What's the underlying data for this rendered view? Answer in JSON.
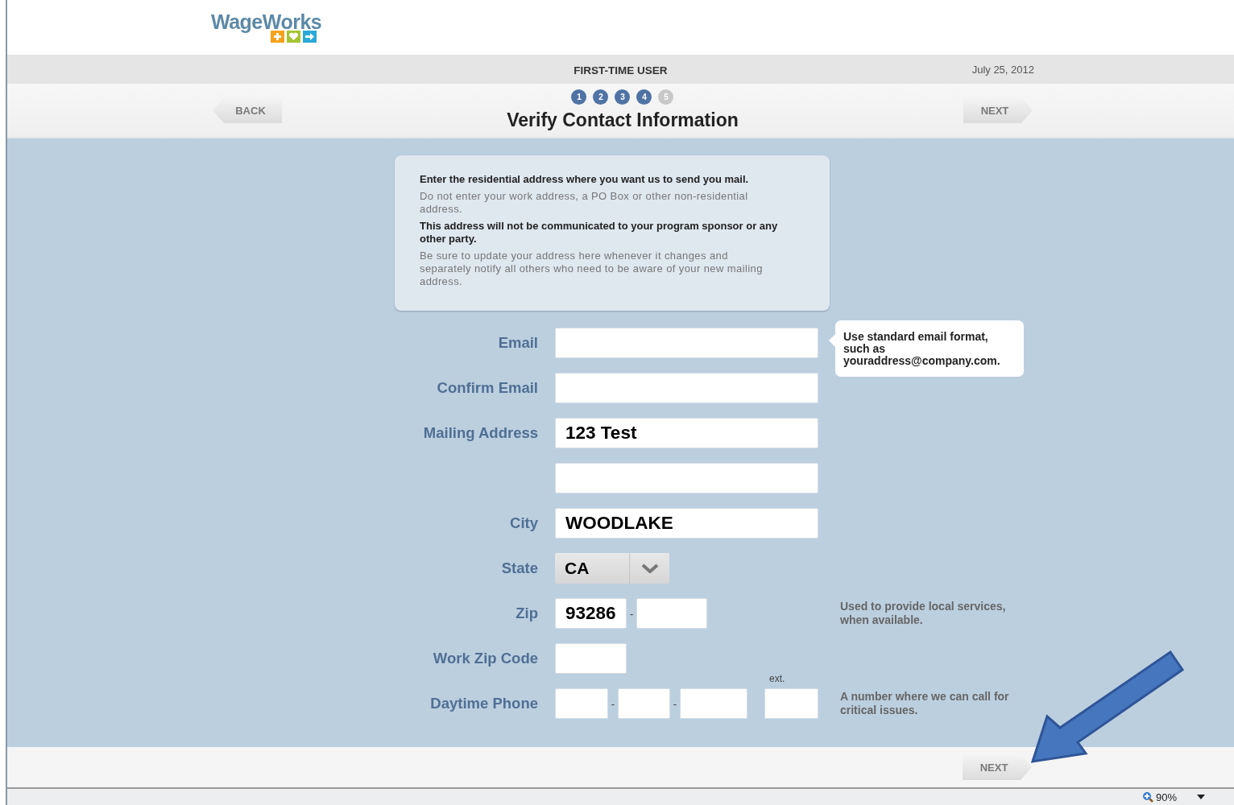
{
  "logo": {
    "text": "WageWorks"
  },
  "header": {
    "title": "FIRST-TIME USER",
    "date": "July 25, 2012"
  },
  "wizard": {
    "back": "BACK",
    "next": "NEXT",
    "title": "Verify Contact Information",
    "steps": [
      {
        "label": "1",
        "done": true
      },
      {
        "label": "2",
        "done": true
      },
      {
        "label": "3",
        "done": true
      },
      {
        "label": "4",
        "done": true
      },
      {
        "label": "5",
        "done": false
      }
    ]
  },
  "notice": [
    {
      "text": "Enter the residential address where you want us to send you mail.",
      "bold": true
    },
    {
      "text": "Do not enter your work address, a PO Box or other non-residential address.",
      "bold": false
    },
    {
      "text": "This address will not be communicated to your program sponsor or any other party.",
      "bold": true
    },
    {
      "text": "Be sure to update your address here whenever it changes and separately notify all others who need to be aware of your new mailing address.",
      "bold": false
    }
  ],
  "fields": [
    {
      "kind": "text",
      "label": "Email",
      "tooltip": "Use standard email format, such as youraddress@company.com."
    },
    {
      "kind": "text",
      "label": "Confirm Email"
    },
    {
      "kind": "text",
      "label": "Mailing Address",
      "value": "123 Test"
    },
    {
      "kind": "text"
    },
    {
      "kind": "text",
      "label": "City",
      "value": "WOODLAKE"
    },
    {
      "kind": "select",
      "label": "State",
      "value": "CA"
    },
    {
      "kind": "zip",
      "label": "Zip",
      "value": "93286",
      "separator": "-",
      "hint": "Used to provide local services, when available."
    },
    {
      "kind": "short",
      "label": "Work Zip Code"
    },
    {
      "kind": "phone",
      "label": "Daytime Phone",
      "separators": [
        "-",
        "-"
      ],
      "ext": "ext.",
      "hint": "A number where we can call for critical issues."
    }
  ],
  "footer": {
    "next": "NEXT"
  },
  "status_bar": {
    "zoom": "90%"
  }
}
